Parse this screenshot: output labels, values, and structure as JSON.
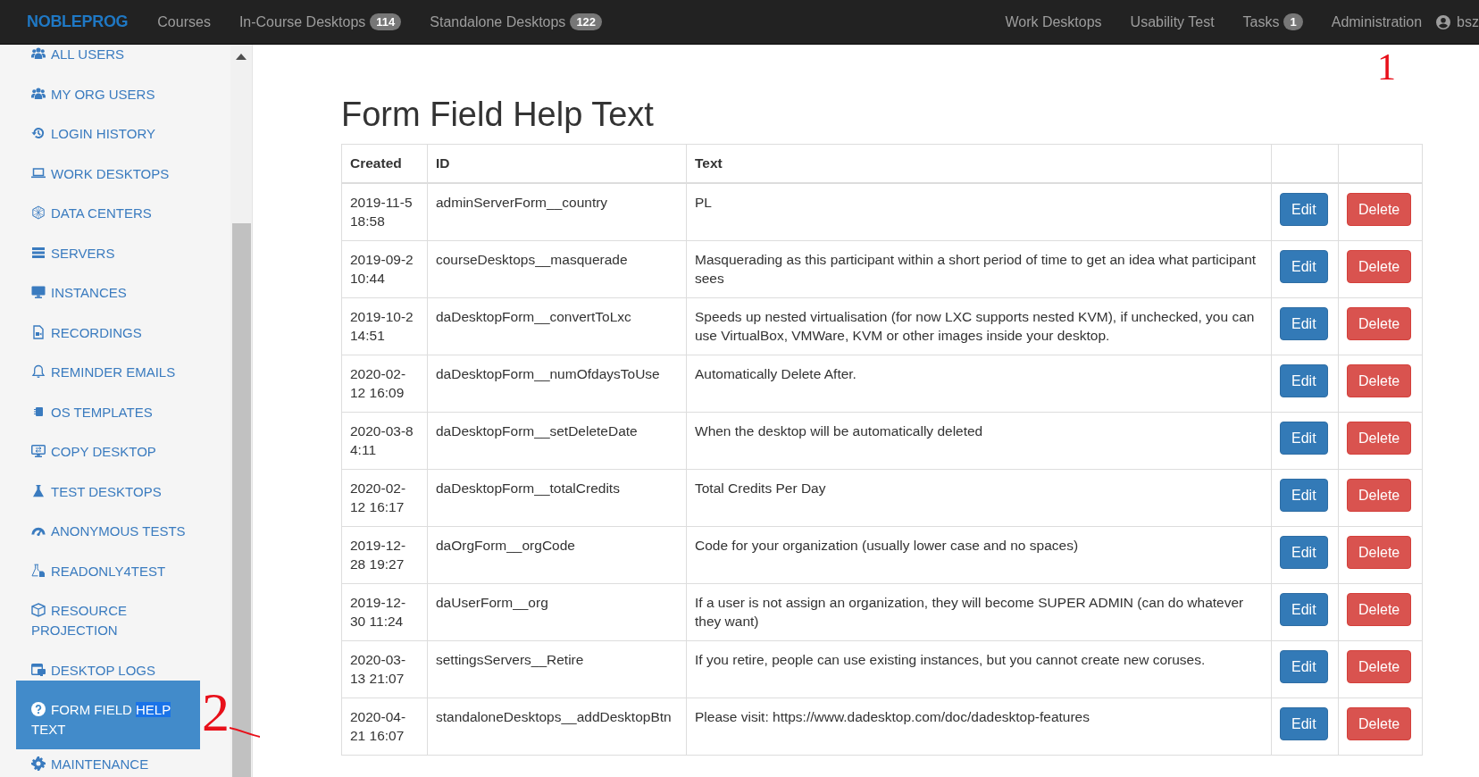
{
  "navbar": {
    "brand": "NOBLEPROG",
    "left_items": [
      {
        "label": "Courses"
      },
      {
        "label": "In-Course Desktops",
        "badge": "114"
      },
      {
        "label": "Standalone Desktops",
        "badge": "122"
      }
    ],
    "right_items": [
      {
        "label": "Work Desktops"
      },
      {
        "label": "Usability Test"
      },
      {
        "label": "Tasks",
        "badge": "1"
      },
      {
        "label": "Administration"
      }
    ],
    "user": {
      "name": "bsz"
    }
  },
  "sidebar": {
    "items": [
      {
        "label": "ALL USERS",
        "selected": false
      },
      {
        "label": "MY ORG USERS",
        "selected": false
      },
      {
        "label": "LOGIN HISTORY",
        "selected": false
      },
      {
        "label": "WORK DESKTOPS",
        "selected": false
      },
      {
        "label": "DATA CENTERS",
        "selected": false
      },
      {
        "label": "SERVERS",
        "selected": false
      },
      {
        "label": "INSTANCES",
        "selected": false
      },
      {
        "label": "RECORDINGS",
        "selected": false
      },
      {
        "label": "REMINDER EMAILS",
        "selected": false
      },
      {
        "label": "OS TEMPLATES",
        "selected": false
      },
      {
        "label": "COPY DESKTOP",
        "selected": false
      },
      {
        "label": "TEST DESKTOPS",
        "selected": false
      },
      {
        "label": "ANONYMOUS TESTS",
        "selected": false
      },
      {
        "label": "READONLY4TEST",
        "selected": false
      },
      {
        "label": "RESOURCE PROJECTION",
        "selected": false
      },
      {
        "label": "DESKTOP LOGS",
        "selected": false
      },
      {
        "label_parts": [
          {
            "text": "FORM FIELD ",
            "highlighted": false
          },
          {
            "text": "HELP",
            "highlighted": true
          },
          {
            "text": " TEXT",
            "highlighted": false
          }
        ],
        "selected": true
      },
      {
        "label": "MAINTENANCE",
        "selected": false
      }
    ]
  },
  "page": {
    "title": "Form Field Help Text"
  },
  "table": {
    "columns": [
      "Created",
      "ID",
      "Text"
    ],
    "rows": [
      {
        "created": "2019-11-5 18:58",
        "id": "adminServerForm__country",
        "text": "PL",
        "buttons": [
          {
            "kind": "edit",
            "label": "Edit"
          },
          {
            "kind": "delete",
            "label": "Delete"
          }
        ]
      },
      {
        "created": "2019-09-2 10:44",
        "id": "courseDesktops__masquerade",
        "text": "Masquerading as this participant within a short period of time to get an idea what participant sees",
        "buttons": [
          {
            "kind": "edit",
            "label": "Edit"
          },
          {
            "kind": "delete",
            "label": "Delete"
          }
        ]
      },
      {
        "created": "2019-10-2 14:51",
        "id": "daDesktopForm__convertToLxc",
        "text": "Speeds up nested virtualisation (for now LXC supports nested KVM), if unchecked, you can use VirtualBox, VMWare, KVM or other images inside your desktop.",
        "buttons": [
          {
            "kind": "edit",
            "label": "Edit"
          },
          {
            "kind": "delete",
            "label": "Delete"
          }
        ]
      },
      {
        "created": "2020-02-12 16:09",
        "id": "daDesktopForm__numOfdaysToUse",
        "text": "Automatically Delete After.",
        "buttons": [
          {
            "kind": "edit",
            "label": "Edit"
          },
          {
            "kind": "delete",
            "label": "Delete"
          }
        ]
      },
      {
        "created": "2020-03-8 4:11",
        "id": "daDesktopForm__setDeleteDate",
        "text": "When the desktop will be automatically deleted",
        "buttons": [
          {
            "kind": "edit",
            "label": "Edit"
          },
          {
            "kind": "delete",
            "label": "Delete"
          }
        ]
      },
      {
        "created": "2020-02-12 16:17",
        "id": "daDesktopForm__totalCredits",
        "text": "Total Credits Per Day",
        "buttons": [
          {
            "kind": "edit",
            "label": "Edit"
          },
          {
            "kind": "delete",
            "label": "Delete"
          }
        ]
      },
      {
        "created": "2019-12-28 19:27",
        "id": "daOrgForm__orgCode",
        "text": "Code for your organization (usually lower case and no spaces)",
        "buttons": [
          {
            "kind": "edit",
            "label": "Edit"
          },
          {
            "kind": "delete",
            "label": "Delete"
          }
        ]
      },
      {
        "created": "2019-12-30 11:24",
        "id": "daUserForm__org",
        "text": "If a user is not assign an organization, they will become SUPER ADMIN (can do whatever they want)",
        "buttons": [
          {
            "kind": "edit",
            "label": "Edit"
          },
          {
            "kind": "delete",
            "label": "Delete"
          }
        ]
      },
      {
        "created": "2020-03-13 21:07",
        "id": "settingsServers__Retire",
        "text": "If you retire, people can use existing instances, but you cannot create new coruses.",
        "buttons": [
          {
            "kind": "edit",
            "label": "Edit"
          },
          {
            "kind": "delete",
            "label": "Delete"
          }
        ]
      },
      {
        "created": "2020-04-21 16:07",
        "id": "standaloneDesktops__addDesktopBtn",
        "text": "Please visit: https://www.dadesktop.com/doc/dadesktop-features",
        "buttons": [
          {
            "kind": "edit",
            "label": "Edit"
          },
          {
            "kind": "delete",
            "label": "Delete"
          }
        ]
      }
    ]
  },
  "annotations": [
    {
      "text": "1"
    },
    {
      "text": "2"
    }
  ]
}
